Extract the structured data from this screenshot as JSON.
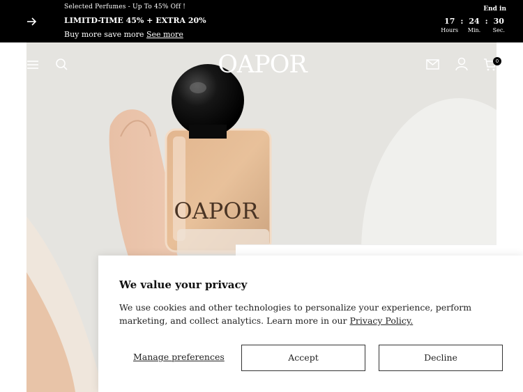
{
  "announcement": {
    "eyebrow": "Selected Perfumes - Up To 45% Off !",
    "headline": "LIMITD-TIME 45% + EXTRA 20%",
    "sub_text": "Buy more save more ",
    "sub_link": "See more",
    "countdown": {
      "label": "End in",
      "hours": "17",
      "minutes": "24",
      "seconds": "30",
      "hours_label": "Hours",
      "minutes_label": "Min.",
      "seconds_label": "Sec.",
      "separator": ":"
    }
  },
  "header": {
    "logo": "OAPOR",
    "cart_count": "0",
    "icons": [
      "menu-icon",
      "search-icon",
      "mail-icon",
      "account-icon",
      "cart-icon"
    ]
  },
  "hero": {
    "bottle_label": "OAPOR"
  },
  "cookie_banner": {
    "title": "We value your privacy",
    "body": "We use cookies and other technologies to personalize your experience, perform marketing, and collect analytics. Learn more in our ",
    "policy_link": "Privacy Policy.",
    "manage_label": "Manage preferences",
    "accept_label": "Accept",
    "decline_label": "Decline"
  }
}
